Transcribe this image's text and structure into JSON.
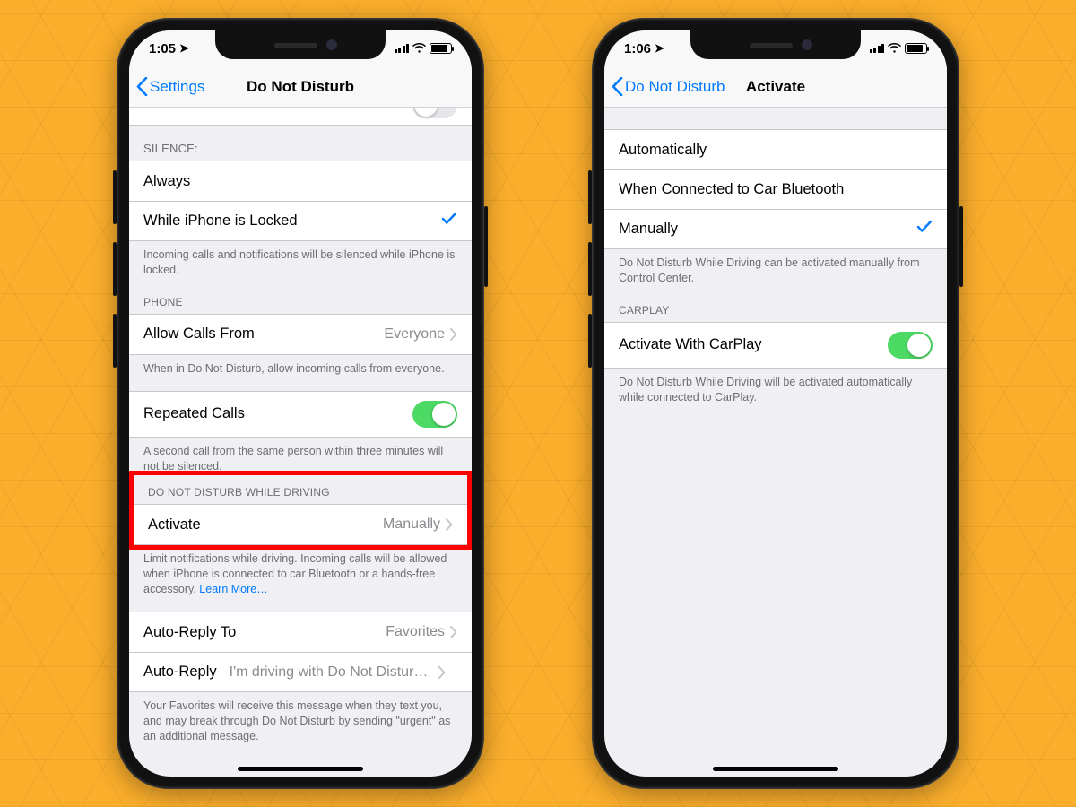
{
  "left": {
    "status_time": "1:05",
    "nav_back": "Settings",
    "nav_title": "Do Not Disturb",
    "silence_header": "SILENCE:",
    "silence_options": [
      "Always",
      "While iPhone is Locked"
    ],
    "silence_selected": 1,
    "silence_footer": "Incoming calls and notifications will be silenced while iPhone is locked.",
    "phone_header": "PHONE",
    "allow_calls_label": "Allow Calls From",
    "allow_calls_value": "Everyone",
    "allow_calls_footer": "When in Do Not Disturb, allow incoming calls from everyone.",
    "repeated_label": "Repeated Calls",
    "repeated_on": true,
    "repeated_footer": "A second call from the same person within three minutes will not be silenced.",
    "dndwd_header": "DO NOT DISTURB WHILE DRIVING",
    "activate_label": "Activate",
    "activate_value": "Manually",
    "activate_footer_a": "Limit notifications while driving. Incoming calls will be allowed when iPhone is connected to car Bluetooth or a hands-free accessory. ",
    "activate_footer_link": "Learn More…",
    "autoreplyto_label": "Auto-Reply To",
    "autoreplyto_value": "Favorites",
    "autoreply_label": "Auto-Reply",
    "autoreply_value": "I'm driving with Do Not Disturb…",
    "autoreply_footer": "Your Favorites will receive this message when they text you, and may break through Do Not Disturb by sending \"urgent\" as an additional message."
  },
  "right": {
    "status_time": "1:06",
    "nav_back": "Do Not Disturb",
    "nav_title": "Activate",
    "options": [
      "Automatically",
      "When Connected to Car Bluetooth",
      "Manually"
    ],
    "selected": 2,
    "options_footer": "Do Not Disturb While Driving can be activated manually from Control Center.",
    "carplay_header": "CARPLAY",
    "carplay_label": "Activate With CarPlay",
    "carplay_on": true,
    "carplay_footer": "Do Not Disturb While Driving will be activated automatically while connected to CarPlay."
  }
}
